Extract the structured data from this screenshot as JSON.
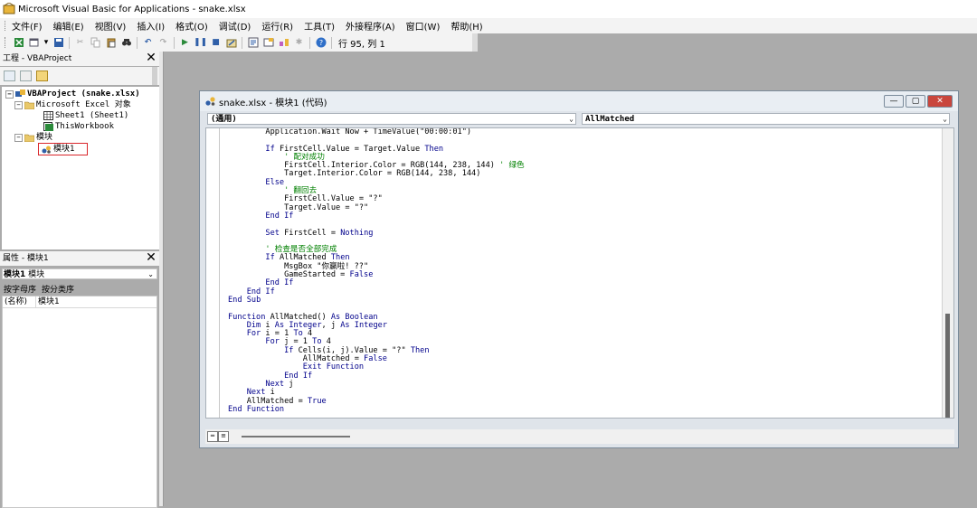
{
  "app": {
    "title": "Microsoft Visual Basic for Applications - snake.xlsx"
  },
  "menu": [
    "文件(F)",
    "编辑(E)",
    "视图(V)",
    "插入(I)",
    "格式(O)",
    "调试(D)",
    "运行(R)",
    "工具(T)",
    "外接程序(A)",
    "窗口(W)",
    "帮助(H)"
  ],
  "toolbar": {
    "position": "行 95, 列 1"
  },
  "project": {
    "title": "工程 - VBAProject",
    "close": "✕",
    "tree": {
      "root": "VBAProject (snake.xlsx)",
      "excel_objects": "Microsoft Excel 对象",
      "sheet1": "Sheet1 (Sheet1)",
      "workbook": "ThisWorkbook",
      "modules": "模块",
      "module1": "模块1"
    }
  },
  "properties": {
    "title": "属性 - 模块1",
    "close": "✕",
    "object_name": "模块1",
    "object_type": "模块",
    "tabs": [
      "按字母序",
      "按分类序"
    ],
    "rows": [
      {
        "name": "(名称)",
        "value": "模块1"
      }
    ]
  },
  "code_window": {
    "title": "snake.xlsx - 模块1 (代码)",
    "object_combo": "(通用)",
    "proc_combo": "AllMatched",
    "win_buttons": [
      "—",
      "▢",
      "✕"
    ],
    "lines": [
      {
        "t": "        Application.Wait Now + TimeValue(\"00:00:01\")"
      },
      {
        "t": ""
      },
      {
        "t": "        If FirstCell.Value = Target.Value Then"
      },
      {
        "t": "            ' 配对成功",
        "c": "cm"
      },
      {
        "t": "            FirstCell.Interior.Color = RGB(144, 238, 144) ' 绿色"
      },
      {
        "t": "            Target.Interior.Color = RGB(144, 238, 144)"
      },
      {
        "t": "        Else"
      },
      {
        "t": "            ' 翻回去",
        "c": "cm"
      },
      {
        "t": "            FirstCell.Value = \"?\""
      },
      {
        "t": "            Target.Value = \"?\""
      },
      {
        "t": "        End If"
      },
      {
        "t": ""
      },
      {
        "t": "        Set FirstCell = Nothing"
      },
      {
        "t": ""
      },
      {
        "t": "        ' 检查是否全部完成",
        "c": "cm"
      },
      {
        "t": "        If AllMatched Then"
      },
      {
        "t": "            MsgBox \"你赢啦! ??\""
      },
      {
        "t": "            GameStarted = False"
      },
      {
        "t": "        End If"
      },
      {
        "t": "    End If"
      },
      {
        "t": "End Sub"
      },
      {
        "t": ""
      },
      {
        "t": "Function AllMatched() As Boolean"
      },
      {
        "t": "    Dim i As Integer, j As Integer"
      },
      {
        "t": "    For i = 1 To 4"
      },
      {
        "t": "        For j = 1 To 4"
      },
      {
        "t": "            If Cells(i, j).Value = \"?\" Then"
      },
      {
        "t": "                AllMatched = False"
      },
      {
        "t": "                Exit Function"
      },
      {
        "t": "            End If"
      },
      {
        "t": "        Next j"
      },
      {
        "t": "    Next i"
      },
      {
        "t": "    AllMatched = True"
      },
      {
        "t": "End Function"
      }
    ]
  },
  "colors": {
    "keyword": "#00008b",
    "comment": "#008000",
    "highlight_box": "#d9262b"
  }
}
